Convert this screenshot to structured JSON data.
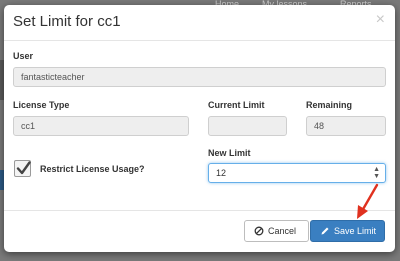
{
  "background": {
    "nav": [
      "Home",
      "My lessons",
      "Reports"
    ]
  },
  "modal": {
    "title": "Set Limit for cc1",
    "close_glyph": "×",
    "user": {
      "label": "User",
      "value": "fantasticteacher"
    },
    "license_type": {
      "label": "License Type",
      "value": "cc1"
    },
    "current_limit": {
      "label": "Current Limit",
      "value": ""
    },
    "remaining": {
      "label": "Remaining",
      "value": "48"
    },
    "restrict": {
      "label": "Restrict License Usage?",
      "checked": true
    },
    "new_limit": {
      "label": "New Limit",
      "value": "12"
    },
    "buttons": {
      "cancel": {
        "label": "Cancel",
        "icon": "ban-icon"
      },
      "save": {
        "label": "Save Limit",
        "icon": "pencil-icon"
      }
    },
    "annotation_arrow_color": "#e0311f"
  }
}
